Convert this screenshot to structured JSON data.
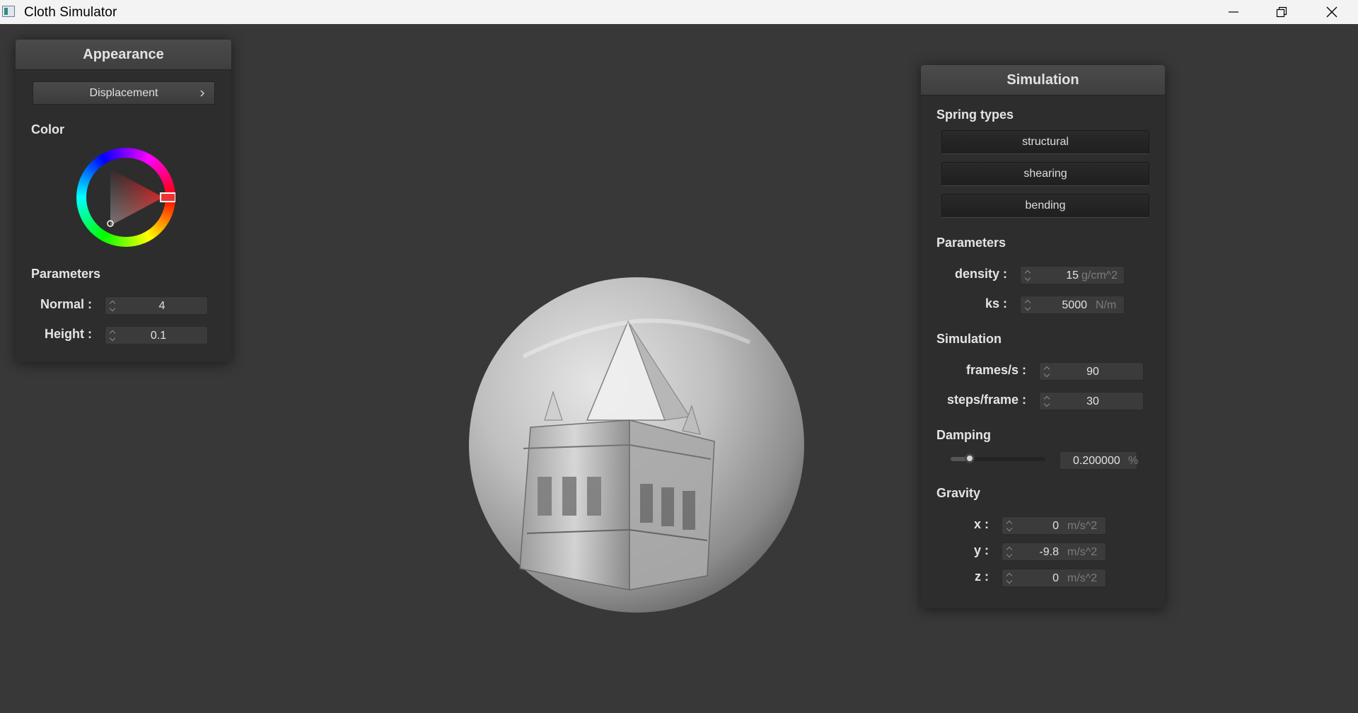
{
  "window": {
    "title": "Cloth Simulator"
  },
  "appearance": {
    "title": "Appearance",
    "shader_selected": "Displacement",
    "color_label": "Color",
    "color_hex": "#c0302e",
    "parameters_label": "Parameters",
    "normal_label": "Normal :",
    "normal_value": "4",
    "height_label": "Height :",
    "height_value": "0.1"
  },
  "simulation_panel": {
    "title": "Simulation",
    "spring_types_label": "Spring types",
    "springs": [
      "structural",
      "shearing",
      "bending"
    ],
    "parameters_label": "Parameters",
    "density_label": "density :",
    "density_value": "15",
    "density_unit": "g/cm^2",
    "ks_label": "ks :",
    "ks_value": "5000",
    "ks_unit": "N/m",
    "simulation_label": "Simulation",
    "fps_label": "frames/s :",
    "fps_value": "90",
    "steps_label": "steps/frame :",
    "steps_value": "30",
    "damping_label": "Damping",
    "damping_level": 0.2,
    "damping_value": "0.200000",
    "damping_unit": "%",
    "gravity_label": "Gravity",
    "gx_label": "x :",
    "gx_value": "0",
    "gy_label": "y :",
    "gy_value": "-9.8",
    "gz_label": "z :",
    "gz_value": "0",
    "g_unit": "m/s^2"
  },
  "icons": {
    "app": "app-icon",
    "minimize": "minimize-icon",
    "restore": "restore-icon",
    "close": "close-icon",
    "popup": "chevron-right-icon",
    "spin": "spin-arrows-icon"
  }
}
